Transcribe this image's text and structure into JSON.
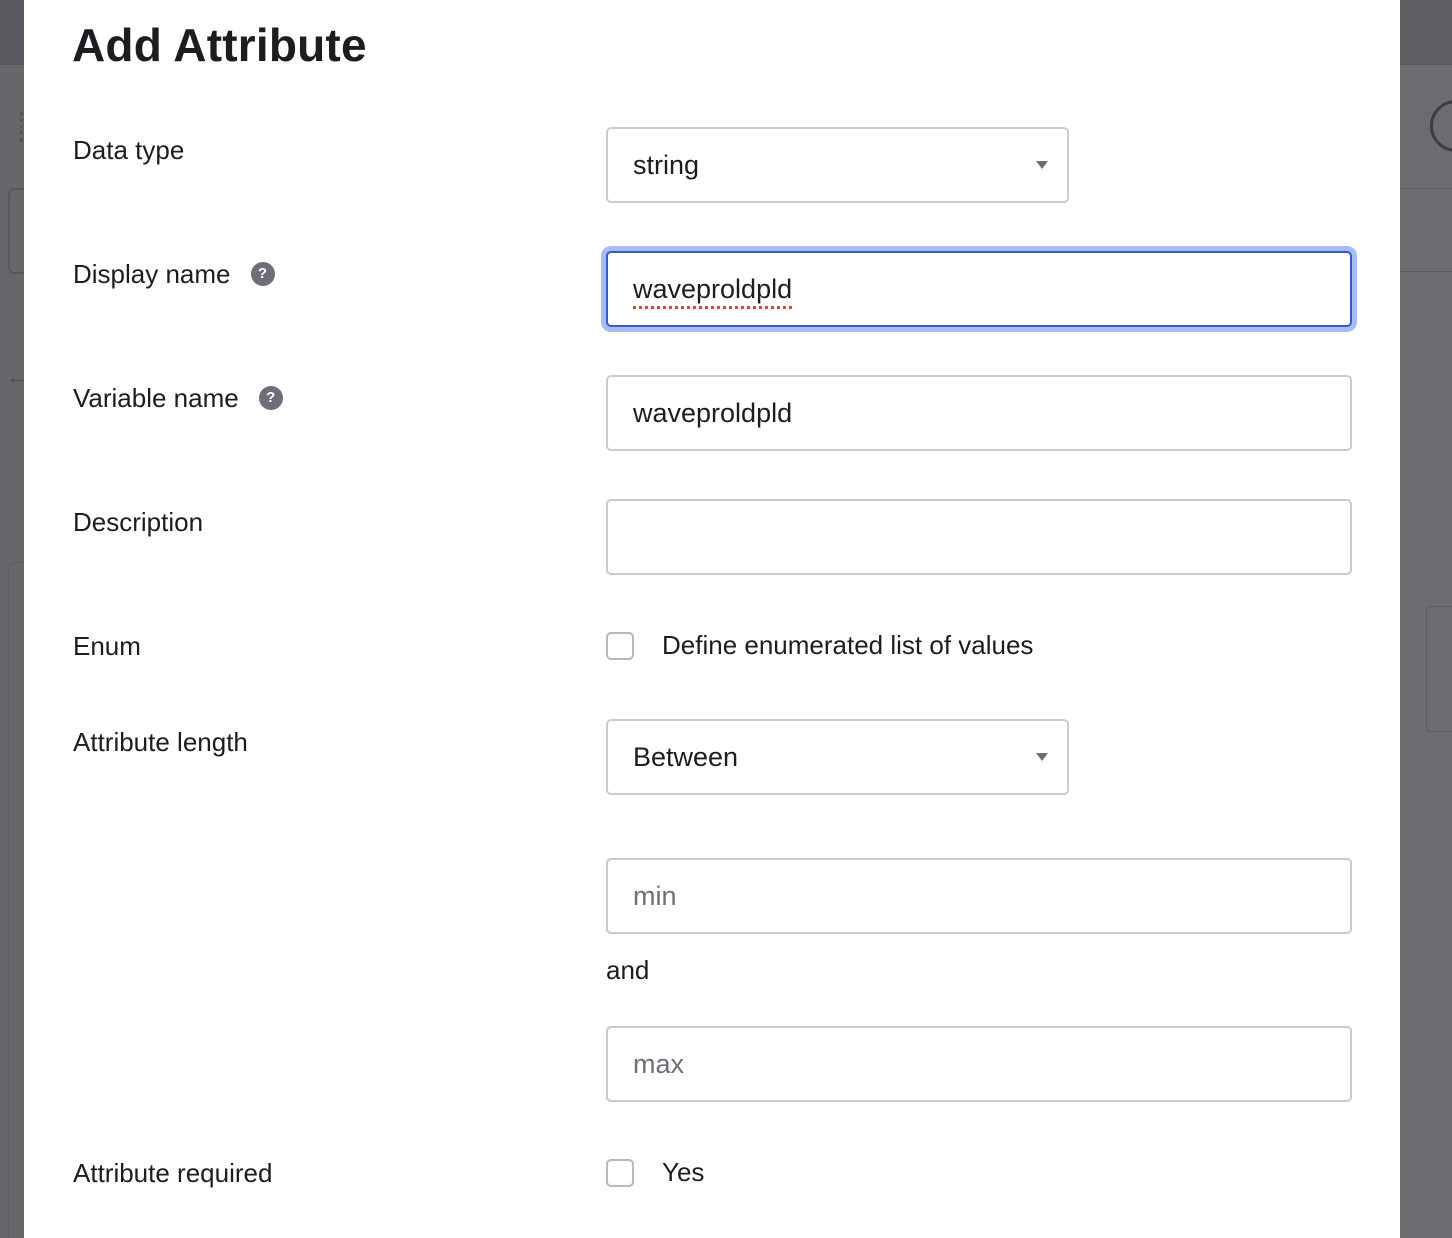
{
  "dialog": {
    "title": "Add Attribute"
  },
  "form": {
    "data_type": {
      "label": "Data type",
      "selected": "string"
    },
    "display_name": {
      "label": "Display name",
      "value": "waveproldpld",
      "help_icon": "question-circle-icon"
    },
    "variable_name": {
      "label": "Variable name",
      "value": "waveproldpld",
      "help_icon": "question-circle-icon"
    },
    "description": {
      "label": "Description",
      "value": ""
    },
    "enum": {
      "label": "Enum",
      "checkbox_label": "Define enumerated list of values",
      "checked": false
    },
    "attribute_length": {
      "label": "Attribute length",
      "selected": "Between",
      "min_placeholder": "min",
      "max_placeholder": "max",
      "and_text": "and"
    },
    "attribute_required": {
      "label": "Attribute required",
      "checkbox_label": "Yes",
      "checked": false
    }
  },
  "colors": {
    "focus_border": "#2e5bd8",
    "focus_ring": "#a9bcf0",
    "overlay": "#6f6f73",
    "spellcheck_underline": "#e0413b"
  }
}
